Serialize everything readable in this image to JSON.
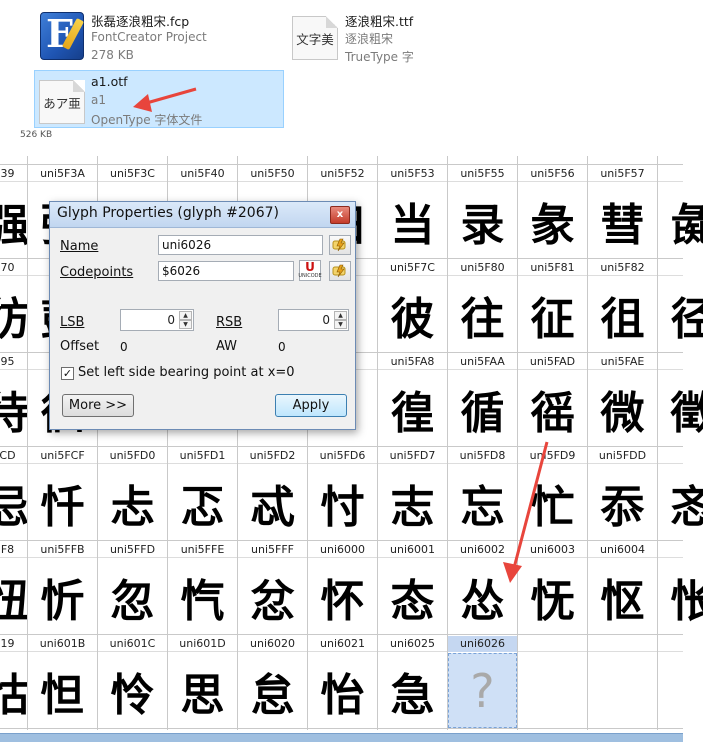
{
  "explorer": {
    "files": [
      {
        "name": "张磊逐浪粗宋.fcp",
        "type": "FontCreator Project",
        "size": "278 KB",
        "icon": "fontcreator-app-icon"
      },
      {
        "name": "逐浪粗宋.ttf",
        "subtitle": "逐浪粗宋",
        "type": "TrueType 字",
        "icon": "truetype-font-icon",
        "preview": "文字美"
      },
      {
        "name": "a1.otf",
        "subtitle": "a1",
        "type": "OpenType 字体文件",
        "icon": "opentype-font-icon",
        "preview": "あア亜",
        "selected": true
      }
    ],
    "partial_size": "526 KB"
  },
  "grid": {
    "label_rows": [
      [
        "39",
        "uni5F3A",
        "uni5F3C",
        "uni5F40",
        "uni5F50",
        "uni5F52",
        "uni5F53",
        "uni5F55",
        "uni5F56",
        "uni5F57",
        ""
      ],
      [
        "70",
        "",
        "",
        "",
        "",
        "B",
        "uni5F7C",
        "uni5F80",
        "uni5F81",
        "uni5F82",
        ""
      ],
      [
        "95",
        "",
        "",
        "",
        "",
        "A1",
        "uni5FA8",
        "uni5FAA",
        "uni5FAD",
        "uni5FAE",
        ""
      ],
      [
        "CD",
        "uni5FCF",
        "uni5FD0",
        "uni5FD1",
        "uni5FD2",
        "uni5FD6",
        "uni5FD7",
        "uni5FD8",
        "uni5FD9",
        "uni5FDD",
        ""
      ],
      [
        "F8",
        "uni5FFB",
        "uni5FFD",
        "uni5FFE",
        "uni5FFF",
        "uni6000",
        "uni6001",
        "uni6002",
        "uni6003",
        "uni6004",
        ""
      ],
      [
        "19",
        "uni601B",
        "uni601C",
        "uni601D",
        "uni6020",
        "uni6021",
        "uni6025",
        "uni6026",
        "",
        "",
        ""
      ]
    ],
    "glyph_rows": [
      [
        "强",
        "弦",
        "",
        "",
        "",
        "归",
        "当",
        "录",
        "彖",
        "彗",
        "彘"
      ],
      [
        "彷",
        "彭",
        "",
        "",
        "",
        "",
        "彼",
        "往",
        "征",
        "徂",
        "径"
      ],
      [
        "待",
        "徊",
        "",
        "",
        "",
        "",
        "徨",
        "循",
        "徭",
        "微",
        "徵"
      ],
      [
        "忌",
        "忏",
        "忐",
        "忑",
        "忒",
        "忖",
        "志",
        "忘",
        "忙",
        "忝",
        "忞"
      ],
      [
        "忸",
        "忻",
        "忽",
        "忾",
        "忿",
        "怀",
        "态",
        "怂",
        "怃",
        "怄",
        "怅"
      ],
      [
        "怙",
        "怛",
        "怜",
        "思",
        "怠",
        "怡",
        "急",
        "?",
        "",
        "",
        ""
      ]
    ],
    "selected_glyph": "uni6026"
  },
  "dialog": {
    "title": "Glyph Properties (glyph #2067)",
    "close_glyph": "x",
    "name_label": "Name",
    "name_value": "uni6026",
    "codepoints_label": "Codepoints",
    "codepoints_value": "$6026",
    "lsb_label": "LSB",
    "lsb_value": "0",
    "rsb_label": "RSB",
    "rsb_value": "0",
    "offset_label": "Offset",
    "offset_value": "0",
    "aw_label": "AW",
    "aw_value": "0",
    "checkbox_label": "Set left side bearing point at x=0",
    "checkbox_mark": "✓",
    "more_button": "More >>",
    "apply_button": "Apply",
    "unicode_btn_main": "U",
    "unicode_btn_sub": "UNICODE"
  },
  "annotations": {
    "arrow_color": "#e8453c"
  }
}
